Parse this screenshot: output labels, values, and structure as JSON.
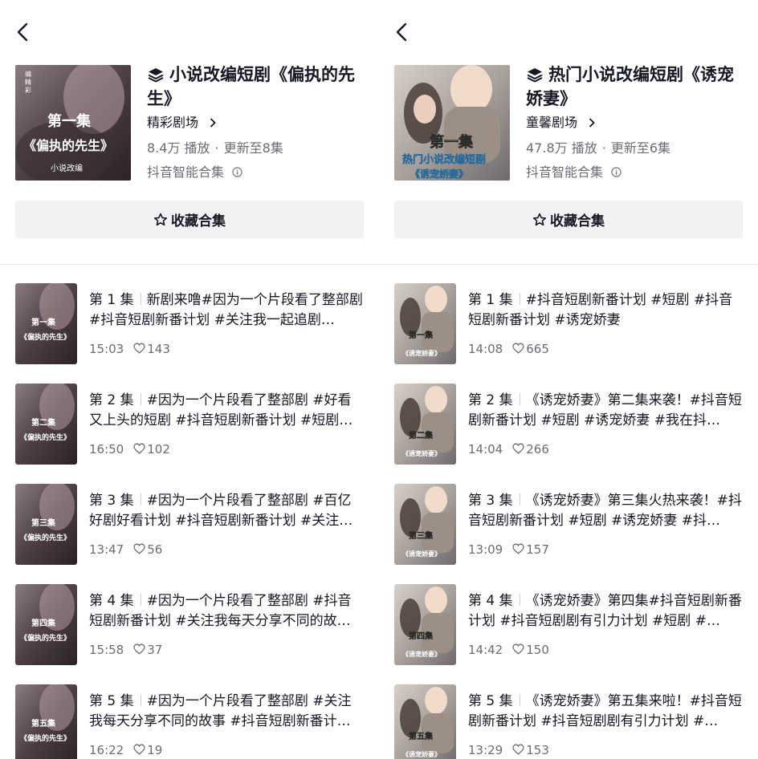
{
  "left": {
    "cover_caption": "第一集",
    "cover_sub": "《偏执的先生》",
    "cover_tag": "小说改编",
    "title": "小说改编短剧《偏执的先生》",
    "channel": "精彩剧场",
    "plays": "8.4万 播放",
    "update": "更新至8集",
    "smart": "抖音智能合集",
    "fav_label": "收藏合集",
    "episodes": [
      {
        "num": "第 1 集",
        "text": "新剧来噜#因为一个片段看了整部剧 #抖音短剧新番计划 #关注我一起追剧…",
        "duration": "15:03",
        "likes": "143",
        "thumb_ep": "第一集"
      },
      {
        "num": "第 2 集",
        "text": "#因为一个片段看了整部剧 #好看又上头的短剧 #抖音短剧新番计划 #短剧…",
        "duration": "16:50",
        "likes": "102",
        "thumb_ep": "第二集"
      },
      {
        "num": "第 3 集",
        "text": "#因为一个片段看了整部剧 #百亿好剧好看计划 #抖音短剧新番计划 #关注…",
        "duration": "13:47",
        "likes": "56",
        "thumb_ep": "第三集"
      },
      {
        "num": "第 4 集",
        "text": "#因为一个片段看了整部剧 #抖音短剧新番计划 #关注我每天分享不同的故…",
        "duration": "15:58",
        "likes": "37",
        "thumb_ep": "第四集"
      },
      {
        "num": "第 5 集",
        "text": "#因为一个片段看了整部剧 #关注我每天分享不同的故事 #抖音短剧新番计…",
        "duration": "16:22",
        "likes": "19",
        "thumb_ep": "第五集"
      }
    ]
  },
  "right": {
    "cover_caption": "第一集",
    "cover_sub": "热门小说改编短剧",
    "cover_tag": "《诱宠娇妻》",
    "title": "热门小说改编短剧《诱宠娇妻》",
    "channel": "童馨剧场",
    "plays": "47.8万 播放",
    "update": "更新至6集",
    "smart": "抖音智能合集",
    "fav_label": "收藏合集",
    "episodes": [
      {
        "num": "第 1 集",
        "text": "#抖音短剧新番计划 #短剧 #抖音短剧新番计划 #诱宠娇妻",
        "duration": "14:08",
        "likes": "665",
        "thumb_ep": "第一集"
      },
      {
        "num": "第 2 集",
        "text": "《诱宠娇妻》第二集来袭！#抖音短剧新番计划 #短剧 #诱宠娇妻 #我在抖…",
        "duration": "14:04",
        "likes": "266",
        "thumb_ep": "第二集"
      },
      {
        "num": "第 3 集",
        "text": "《诱宠娇妻》第三集火热来袭！#抖音短剧新番计划 #短剧 #诱宠娇妻 #抖…",
        "duration": "13:09",
        "likes": "157",
        "thumb_ep": "第三集"
      },
      {
        "num": "第 4 集",
        "text": "《诱宠娇妻》第四集#抖音短剧新番计划 #抖音短剧剧有引力计划 #短剧 #…",
        "duration": "14:42",
        "likes": "150",
        "thumb_ep": "第四集"
      },
      {
        "num": "第 5 集",
        "text": "《诱宠娇妻》第五集来啦！#抖音短剧新番计划 #抖音短剧剧有引力计划 #…",
        "duration": "13:29",
        "likes": "153",
        "thumb_ep": "第五集"
      }
    ]
  }
}
